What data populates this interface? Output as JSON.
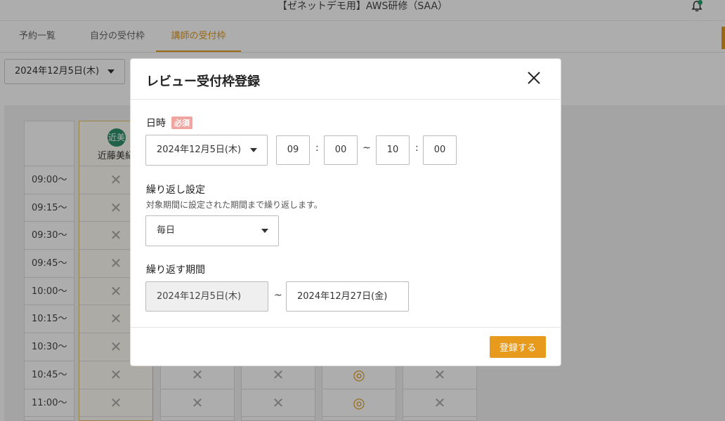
{
  "app": {
    "title": "【ゼネットデモ用】AWS研修（SAA）",
    "accent_color": "#e89a1c"
  },
  "tabs": [
    {
      "label": "予約一覧",
      "active": false
    },
    {
      "label": "自分の受付枠",
      "active": false
    },
    {
      "label": "講師の受付枠",
      "active": true
    }
  ],
  "toolbar": {
    "date_select_value": "2024年12月5日(木)"
  },
  "schedule": {
    "instructor": {
      "avatar_text": "近美",
      "name": "近藤美紀"
    },
    "times": [
      "09:00〜",
      "09:15〜",
      "09:30〜",
      "09:45〜",
      "10:00〜",
      "10:15〜",
      "10:30〜",
      "10:45〜",
      "11:00〜"
    ],
    "unavailable_mark": "✕",
    "available_mark": "◎"
  },
  "modal": {
    "title": "レビュー受付枠登録",
    "datetime": {
      "label": "日時",
      "required_badge": "必須",
      "date_value": "2024年12月5日(木)",
      "start_hour": "09",
      "start_minute": "00",
      "end_hour": "10",
      "end_minute": "00",
      "time_separator": ":",
      "range_separator": "~"
    },
    "repeat": {
      "label": "繰り返し設定",
      "hint": "対象期間に設定された期間まで繰り返します。",
      "value": "毎日"
    },
    "period": {
      "label": "繰り返す期間",
      "start": "2024年12月5日(木)",
      "separator": "~",
      "end": "2024年12月27日(金)"
    },
    "submit_label": "登録する"
  }
}
